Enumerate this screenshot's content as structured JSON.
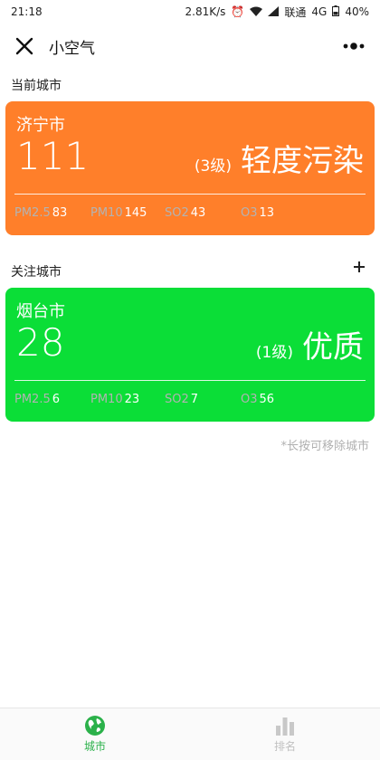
{
  "status_bar": {
    "time": "21:18",
    "speed": "2.81K/s",
    "carrier": "联通",
    "network": "4G",
    "battery": "40%"
  },
  "nav": {
    "title": "小空气",
    "close_icon": "close-icon",
    "menu_icon": "more-options-icon"
  },
  "current_section": {
    "label": "当前城市"
  },
  "current_city": {
    "name": "济宁市",
    "aqi": "111",
    "level_num": "(3级)",
    "level_text": "轻度污染",
    "color": "#FF7F2A",
    "metrics": [
      {
        "label": "PM2.5",
        "value": "83"
      },
      {
        "label": "PM10",
        "value": "145"
      },
      {
        "label": "SO2",
        "value": "43"
      },
      {
        "label": "O3",
        "value": "13"
      }
    ]
  },
  "follow_section": {
    "label": "关注城市",
    "add_label": "+"
  },
  "follow_cities": [
    {
      "name": "烟台市",
      "aqi": "28",
      "level_num": "(1级)",
      "level_text": "优质",
      "color": "#0BDE37",
      "metrics": [
        {
          "label": "PM2.5",
          "value": "6"
        },
        {
          "label": "PM10",
          "value": "23"
        },
        {
          "label": "SO2",
          "value": "7"
        },
        {
          "label": "O3",
          "value": "56"
        }
      ]
    }
  ],
  "hint": "*长按可移除城市",
  "tabbar": {
    "tabs": [
      {
        "label": "城市",
        "icon": "globe-icon",
        "active": true
      },
      {
        "label": "排名",
        "icon": "bar-chart-icon",
        "active": false
      }
    ],
    "active_color": "#2BB14A",
    "inactive_color": "#C0C0C0"
  }
}
